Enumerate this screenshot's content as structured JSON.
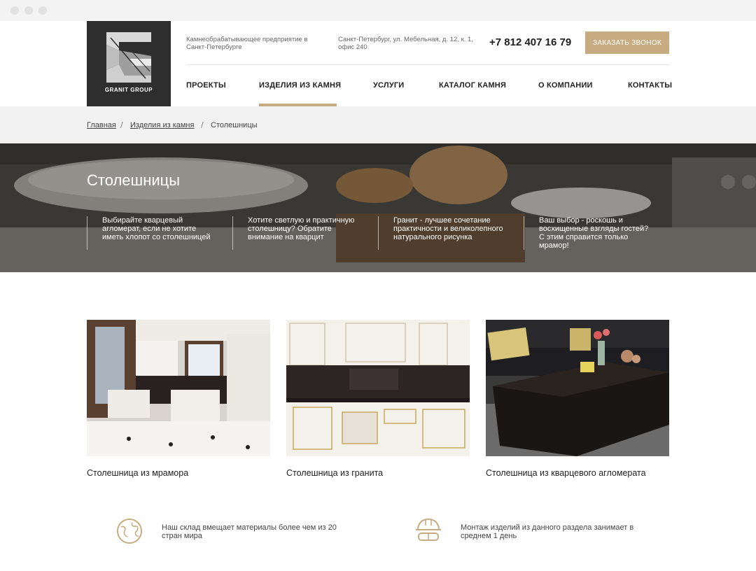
{
  "header": {
    "logo_text": "GRANIT GROUP",
    "description": "Камнеобрабатывающее предприятие в Санкт-Петербурге",
    "address": "Санкт-Петербург, ул. Мебельная, д. 12, к. 1, офис 240",
    "phone": "+7 812 407 16 79",
    "call_button": "ЗАКАЗАТЬ ЗВОНОК"
  },
  "nav": {
    "items": [
      "ПРОЕКТЫ",
      "ИЗДЕЛИЯ ИЗ КАМНЯ",
      "УСЛУГИ",
      "КАТАЛОГ КАМНЯ",
      "О КОМПАНИИ",
      "КОНТАКТЫ"
    ],
    "active": "ИЗДЕЛИЯ ИЗ КАМНЯ"
  },
  "breadcrumbs": [
    "Главная",
    "Изделия из камня",
    "Столешницы"
  ],
  "hero": {
    "title": "Столешницы",
    "features": [
      "Выбирайте кварцевый агломерат, если не хотите иметь хлопот со столешницей",
      "Хотите светлую и практичную столешницу? Обратите внимание на кварцит",
      "Гранит - лучшее сочетание практичности и великолепного натурального рисунка",
      "Ваш выбор - роскошь и восхищенные взгляды гостей? С этим справится только мрамор!"
    ]
  },
  "cards": [
    {
      "title": "Столешница из мрамора"
    },
    {
      "title": "Столешница из гранита"
    },
    {
      "title": "Столешница из кварцевого агломерата"
    }
  ],
  "info": [
    {
      "icon": "globe-icon",
      "text": "Наш склад вмещает материалы более чем из 20 стран мира"
    },
    {
      "icon": "worker-helmet-icon",
      "text": "Монтаж изделий из данного раздела занимает в среднем 1 день"
    }
  ],
  "colors": {
    "accent": "#c6ac80",
    "logo_bg": "#2e2e2e",
    "breadcrumb_bg": "#f1f1f1"
  }
}
